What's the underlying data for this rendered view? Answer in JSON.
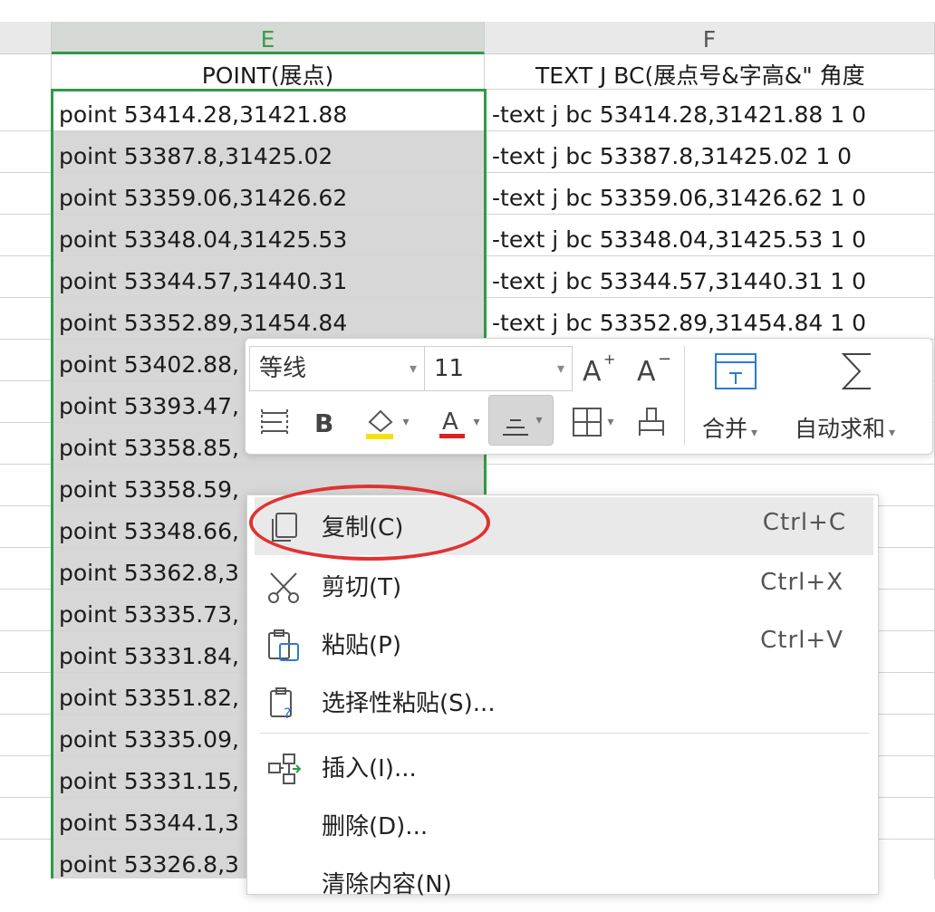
{
  "columns": {
    "e": "E",
    "f": "F"
  },
  "header_row": {
    "e": "POINT(展点)",
    "f": "TEXT J BC(展点号&字高&\" 角度"
  },
  "rows": [
    {
      "e": "point 53414.28,31421.88",
      "f": "-text j bc 53414.28,31421.88 1 0"
    },
    {
      "e": "point 53387.8,31425.02",
      "f": "-text j bc 53387.8,31425.02 1 0"
    },
    {
      "e": "point 53359.06,31426.62",
      "f": "-text j bc 53359.06,31426.62 1 0"
    },
    {
      "e": "point 53348.04,31425.53",
      "f": "-text j bc 53348.04,31425.53 1 0"
    },
    {
      "e": "point 53344.57,31440.31",
      "f": "-text j bc 53344.57,31440.31 1 0"
    },
    {
      "e": "point 53352.89,31454.84",
      "f": "-text j bc 53352.89,31454.84 1 0"
    },
    {
      "e": "point 53402.88,",
      "f": ""
    },
    {
      "e": "point 53393.47,",
      "f": ""
    },
    {
      "e": "point 53358.85,",
      "f": ""
    },
    {
      "e": "point 53358.59,",
      "f": ""
    },
    {
      "e": "point 53348.66,",
      "f": ""
    },
    {
      "e": "point 53362.8,3",
      "f": ""
    },
    {
      "e": "point 53335.73,",
      "f": ""
    },
    {
      "e": "point 53331.84,",
      "f": ""
    },
    {
      "e": "point 53351.82,",
      "f": ""
    },
    {
      "e": "point 53335.09,",
      "f": ""
    },
    {
      "e": "point 53331.15,",
      "f": ""
    },
    {
      "e": "point 53344.1,3",
      "f": ""
    },
    {
      "e": "point 53326.8,3",
      "f": ""
    }
  ],
  "toolbar": {
    "font_name": "等线",
    "font_size": "11",
    "merge_label": "合并",
    "autosum_label": "自动求和"
  },
  "context_menu": {
    "items": [
      {
        "label": "复制(C)",
        "shortcut": "Ctrl+C"
      },
      {
        "label": "剪切(T)",
        "shortcut": "Ctrl+X"
      },
      {
        "label": "粘贴(P)",
        "shortcut": "Ctrl+V"
      },
      {
        "label": "选择性粘贴(S)...",
        "shortcut": ""
      },
      {
        "label": "插入(I)...",
        "shortcut": ""
      },
      {
        "label": "删除(D)...",
        "shortcut": ""
      },
      {
        "label": "清除内容(N)",
        "shortcut": ""
      }
    ]
  },
  "colors": {
    "selection": "#2f9a44",
    "annotation_circle": "#e03232",
    "font_color_underline": "#e02020",
    "fill_color_underline": "#f5e10a"
  }
}
